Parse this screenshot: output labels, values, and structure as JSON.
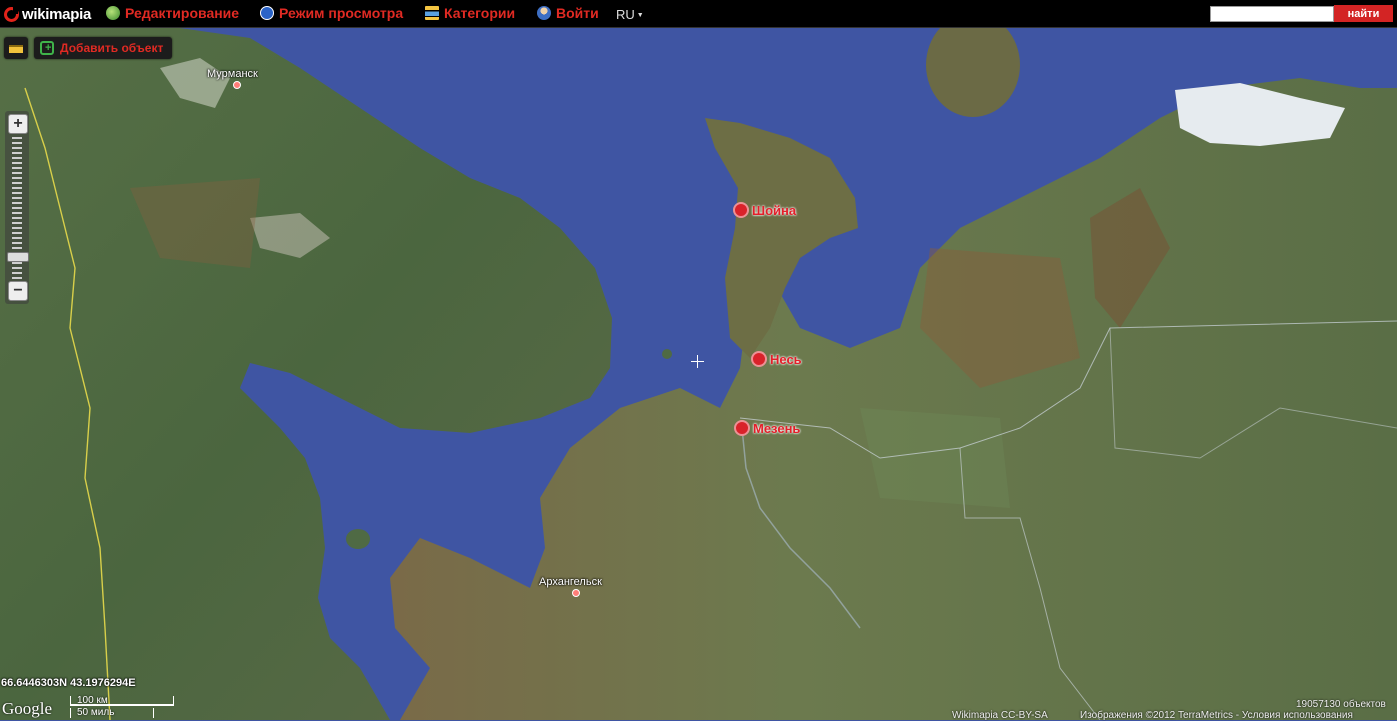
{
  "header": {
    "logo_text": "wikimapia",
    "nav": [
      {
        "label": "Редактирование",
        "icon": "globe-edit-icon"
      },
      {
        "label": "Режим просмотра",
        "icon": "compass-icon"
      },
      {
        "label": "Категории",
        "icon": "categories-icon"
      },
      {
        "label": "Войти",
        "icon": "user-icon"
      }
    ],
    "language": "RU",
    "search_value": "",
    "search_button": "найти"
  },
  "toolbar": {
    "ruler_icon": "ruler-icon",
    "add_object_label": "Добавить объект",
    "add_object_icon": "add-place-icon"
  },
  "zoom": {
    "plus": "+",
    "minus": "−",
    "level_fraction": 0.86
  },
  "cities": {
    "murmansk": "Мурманск",
    "arkhangelsk": "Архангельск"
  },
  "places": {
    "shoyna": "Шойна",
    "nes": "Несь",
    "mezen": "Мезень"
  },
  "status": {
    "coordinates": "66.6446303N 43.1976294E",
    "google": "Google",
    "scale_km": "100 км",
    "scale_mi": "50 миль",
    "attribution_left": "Wikimapia CC-BY-SA",
    "attribution_right": "Изображения ©2012 TerraMetrics - Условия использования",
    "object_count": "19057130 объектов"
  },
  "colors": {
    "sea": "#3f55a3",
    "land": "#4e6a45",
    "brand_red": "#e02a23"
  }
}
